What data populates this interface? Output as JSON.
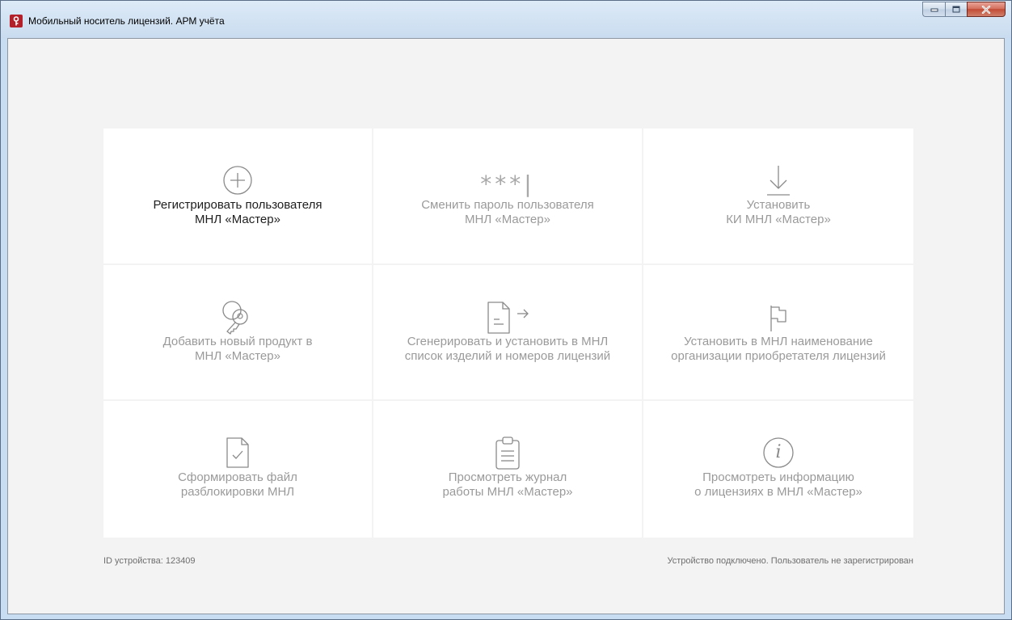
{
  "window": {
    "title": "Мобильный носитель лицензий. АРМ учёта"
  },
  "tiles": [
    {
      "label": "Регистрировать пользователя\nМНЛ «Мастер»",
      "icon": "plus-circle-icon",
      "active": true
    },
    {
      "label": "Сменить пароль пользователя\nМНЛ «Мастер»",
      "icon": "password-asterisks-icon",
      "icon_text": "***|",
      "active": false
    },
    {
      "label": "Установить\nКИ МНЛ «Мастер»",
      "icon": "download-arrow-icon",
      "active": false
    },
    {
      "label": "Добавить новый продукт в\nМНЛ «Мастер»",
      "icon": "keys-icon",
      "active": false
    },
    {
      "label": "Сгенерировать и установить в МНЛ\nсписок изделий и номеров лицензий",
      "icon": "document-arrow-icon",
      "active": false
    },
    {
      "label": "Установить в МНЛ наименование\nорганизации приобретателя лицензий",
      "icon": "flag-icon",
      "active": false
    },
    {
      "label": "Сформировать файл\nразблокировки МНЛ",
      "icon": "document-check-icon",
      "active": false
    },
    {
      "label": "Просмотреть журнал\nработы МНЛ «Мастер»",
      "icon": "clipboard-icon",
      "active": false
    },
    {
      "label": "Просмотреть информацию\nо лицензиях в МНЛ «Мастер»",
      "icon": "info-circle-icon",
      "icon_text": "i",
      "active": false
    }
  ],
  "status": {
    "device_id": "ID устройства: 123409",
    "connection": "Устройство подключено. Пользователь не зарегистрирован"
  },
  "colors": {
    "active_text": "#1e1e1e",
    "inactive_text": "#9a9a9a",
    "icon_stroke": "#8a8a8a",
    "app_icon": "#b3202a"
  }
}
